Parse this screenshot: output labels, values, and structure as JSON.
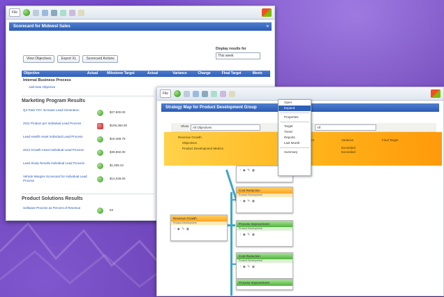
{
  "browser": {
    "file_label": "File"
  },
  "back_window": {
    "title": "Scorecard for Midwest Sales",
    "buttons": [
      "View Objectives",
      "Export XL",
      "Scorecard Actions"
    ],
    "display_results": {
      "label": "Display results for",
      "value": "This week"
    },
    "table": {
      "columns": [
        "Objective",
        "Actual",
        "Milestone Target",
        "Actual",
        "Variance",
        "Change",
        "Final Target",
        "Meets"
      ],
      "section": "Internal Business Process",
      "link": "Add New Objective"
    },
    "section_title": "Marketing Program Results",
    "rows": [
      {
        "title": "Q3 Total YOY Increase Lead Generation",
        "status": "ok",
        "value": "$27,500.00"
      },
      {
        "title": "2011 Product per Individual Lead Process",
        "status": "bad",
        "value": "$108,360.00"
      },
      {
        "title": "Lead Health Asset Individual Lead Process",
        "status": "ok",
        "value": "$19,468.79"
      },
      {
        "title": "2012 Growth Asset Individual Lead Process",
        "status": "ok",
        "value": "$39,592.00"
      },
      {
        "title": "Lead Study Results Individual Lead Process",
        "status": "ok",
        "value": "$1,935.22"
      },
      {
        "title": "Vehicle Margins Scorecard for Individual Lead Process",
        "status": "ok",
        "value": "$14,048.00"
      }
    ],
    "section2_title": "Product Solutions Results",
    "row2": {
      "title": "Software Process as Percent of Revenue",
      "status": "ok",
      "value": "63"
    }
  },
  "front_window": {
    "title": "Strategy Map for Product Development Group",
    "filter": {
      "show_label": "Show",
      "show_value": "All Objectives",
      "date_label": "Date type",
      "date_value": "All"
    },
    "band": {
      "left_items": [
        "Revenue Growth",
        "Objectives",
        "Product Development Metrics"
      ],
      "col_headers": [
        "Milestone Target",
        "Variance",
        "Final Target"
      ],
      "col1_values": [
        "Actual",
        "Exceeded"
      ],
      "col2_values": [
        "Exceeded",
        "Exceeded"
      ]
    },
    "cards": [
      {
        "label": "Revenue Growth",
        "sub": "Product Development",
        "color": "orange"
      },
      {
        "label": "Cost Reduction",
        "sub": "Product Development",
        "color": "orange"
      },
      {
        "label": "Process Improvement",
        "sub": "Product Development",
        "color": "green"
      },
      {
        "label": "Cost Reduction",
        "sub": "Product Development",
        "color": "green"
      },
      {
        "label": "Process Improvement",
        "sub": "Product Development",
        "color": "green"
      },
      {
        "label": "Revenue Growth",
        "sub": "Product Development",
        "color": "green"
      }
    ],
    "context_menu": [
      "Open",
      "Expand",
      "",
      "Properties",
      "",
      "Target",
      "Trend",
      "Reports",
      "Last Month",
      "",
      "Summary"
    ],
    "context_highlight": 1
  },
  "colors": {
    "background": "#6a3fb3",
    "title_bar": "#2c5cb3",
    "band": "#ffb31a",
    "ok": "#3a9a2a",
    "bad": "#c62121"
  }
}
